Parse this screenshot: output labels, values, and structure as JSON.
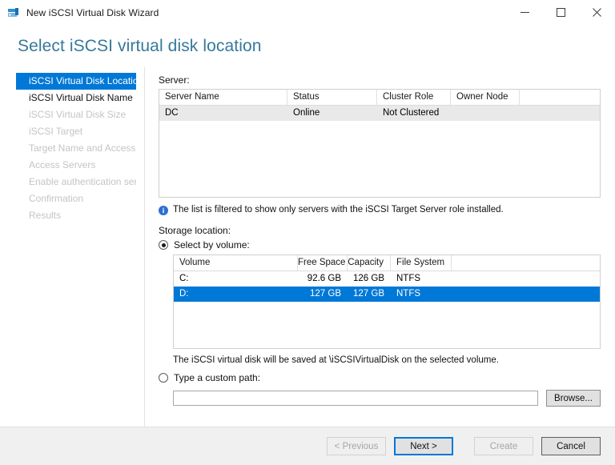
{
  "window": {
    "title": "New iSCSI Virtual Disk Wizard",
    "icon": "iscsi-disk-icon",
    "controls": {
      "minimize": "—",
      "maximize": "☐",
      "close": "✕"
    }
  },
  "header": {
    "title": "Select iSCSI virtual disk location",
    "accent_color": "#35799a"
  },
  "sidebar": {
    "items": [
      {
        "label": "iSCSI Virtual Disk Location",
        "state": "selected"
      },
      {
        "label": "iSCSI Virtual Disk Name",
        "state": "enabled"
      },
      {
        "label": "iSCSI Virtual Disk Size",
        "state": "disabled"
      },
      {
        "label": "iSCSI Target",
        "state": "disabled"
      },
      {
        "label": "Target Name and Access",
        "state": "disabled"
      },
      {
        "label": "Access Servers",
        "state": "disabled"
      },
      {
        "label": "Enable authentication ser...",
        "state": "disabled"
      },
      {
        "label": "Confirmation",
        "state": "disabled"
      },
      {
        "label": "Results",
        "state": "disabled"
      }
    ],
    "selection_color": "#0078d7"
  },
  "main": {
    "server_label": "Server:",
    "server_table": {
      "columns": [
        "Server Name",
        "Status",
        "Cluster Role",
        "Owner Node"
      ],
      "rows": [
        {
          "cells": [
            "DC",
            "Online",
            "Not Clustered",
            ""
          ],
          "selected": true
        }
      ]
    },
    "info": {
      "icon": "info-icon",
      "glyph": "i",
      "text": "The list is filtered to show only servers with the iSCSI Target Server role installed."
    },
    "storage_label": "Storage location:",
    "option_volume": {
      "label": "Select by volume:",
      "checked": true
    },
    "volume_table": {
      "columns": [
        "Volume",
        "Free Space",
        "Capacity",
        "File System"
      ],
      "rows": [
        {
          "cells": [
            "C:",
            "92.6 GB",
            "126 GB",
            "NTFS"
          ],
          "selected": false
        },
        {
          "cells": [
            "D:",
            "127 GB",
            "127 GB",
            "NTFS"
          ],
          "selected": true
        }
      ]
    },
    "save_note": "The iSCSI virtual disk will be saved at \\iSCSIVirtualDisk on the selected volume.",
    "option_custom": {
      "label": "Type a custom path:",
      "checked": false
    },
    "custom_path": {
      "value": "",
      "placeholder": ""
    },
    "browse_label": "Browse..."
  },
  "footer": {
    "previous_label": "< Previous",
    "next_label": "Next >",
    "create_label": "Create",
    "cancel_label": "Cancel"
  }
}
